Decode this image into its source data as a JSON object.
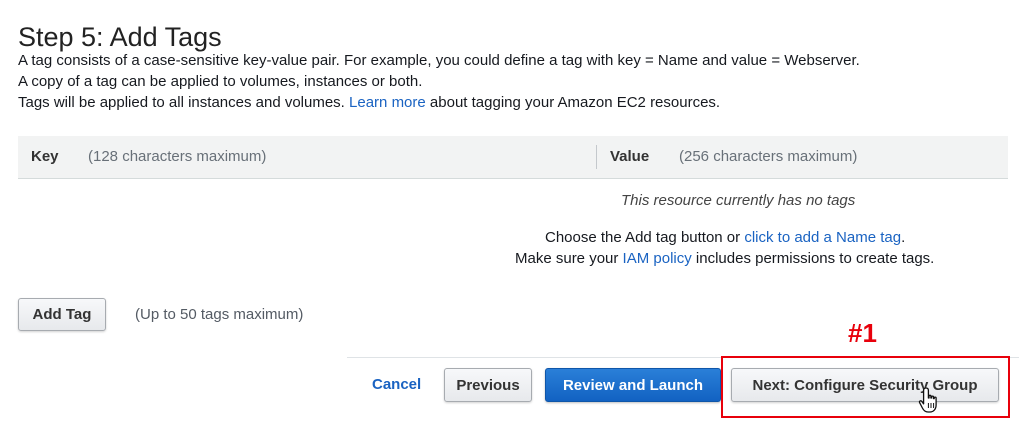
{
  "page": {
    "title": "Step 5: Add Tags",
    "line1": "A tag consists of a case-sensitive key-value pair. For example, you could define a tag with key = Name and value = Webserver.",
    "line2": "A copy of a tag can be applied to volumes, instances or both.",
    "line3_pre": "Tags will be applied to all instances and volumes.",
    "line3_link": "Learn more",
    "line3_post": "about tagging your Amazon EC2 resources."
  },
  "table": {
    "key_header": "Key",
    "key_hint": "(128 characters maximum)",
    "value_header": "Value",
    "value_hint": "(256 characters maximum)",
    "empty_message": "This resource currently has no tags"
  },
  "help": {
    "line1_pre": "Choose the Add tag button or",
    "line1_link": "click to add a Name tag",
    "line1_post": ".",
    "line2_pre": "Make sure your",
    "line2_link": "IAM policy",
    "line2_post": "includes permissions to create tags."
  },
  "add_tag": {
    "label": "Add Tag",
    "hint": "(Up to 50 tags maximum)"
  },
  "footer": {
    "cancel": "Cancel",
    "previous": "Previous",
    "review": "Review and Launch",
    "next": "Next: Configure Security Group"
  },
  "annotation": {
    "label": "#1"
  },
  "colors": {
    "primary": "#1262c2",
    "link": "#1a63c2",
    "annotation": "#e8000b"
  }
}
